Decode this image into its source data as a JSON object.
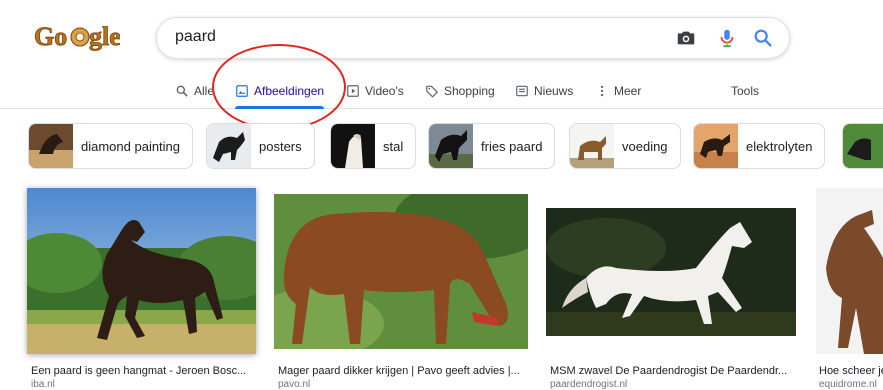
{
  "logo": {
    "text": "Google"
  },
  "search": {
    "query": "paard"
  },
  "tabs": [
    {
      "label": "Alle"
    },
    {
      "label": "Afbeeldingen"
    },
    {
      "label": "Video's"
    },
    {
      "label": "Shopping"
    },
    {
      "label": "Nieuws"
    },
    {
      "label": "Meer"
    },
    {
      "label": "Tools"
    }
  ],
  "chips": [
    {
      "label": "diamond painting"
    },
    {
      "label": "posters"
    },
    {
      "label": "stal"
    },
    {
      "label": "fries paard"
    },
    {
      "label": "voeding"
    },
    {
      "label": "elektrolyten"
    }
  ],
  "results": [
    {
      "title": "Een paard is geen hangmat - Jeroen Bosc...",
      "source": "iba.nl"
    },
    {
      "title": "Mager paard dikker krijgen | Pavo geeft advies |...",
      "source": "pavo.nl"
    },
    {
      "title": "MSM zwavel De Paardendrogist De Paardendr...",
      "source": "paardendrogist.nl"
    },
    {
      "title": "Hoe scheer je een paard",
      "source": "equidrome.nl"
    }
  ],
  "colors": {
    "accent": "#1a73e8",
    "annotation": "#e3251f",
    "link": "#1a0dab"
  }
}
